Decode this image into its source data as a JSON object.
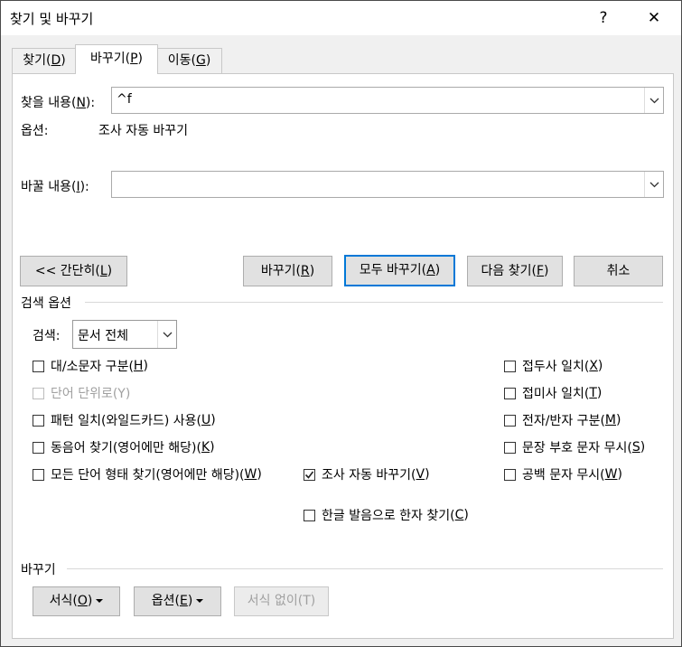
{
  "window": {
    "title": "찾기 및 바꾸기",
    "help": "?",
    "close": "✕"
  },
  "tabs": [
    {
      "label": "찾기(",
      "key": "D",
      "tail": ")"
    },
    {
      "label": "바꾸기(",
      "key": "P",
      "tail": ")"
    },
    {
      "label": "이동(",
      "key": "G",
      "tail": ")"
    }
  ],
  "find": {
    "label": "찾을 내용(",
    "key": "N",
    "tail": "):",
    "value": "^f"
  },
  "options_line": {
    "label": "옵션:",
    "value": "조사 자동 바꾸기"
  },
  "replace": {
    "label": "바꿀 내용(",
    "key": "I",
    "tail": "):",
    "value": ""
  },
  "buttons": {
    "less": {
      "label": "<< 간단히(",
      "key": "L",
      "tail": ")"
    },
    "replace": {
      "label": "바꾸기(",
      "key": "R",
      "tail": ")"
    },
    "replace_all": {
      "label": "모두 바꾸기(",
      "key": "A",
      "tail": ")"
    },
    "find_next": {
      "label": "다음 찾기(",
      "key": "F",
      "tail": ")"
    },
    "cancel": {
      "label": "취소"
    }
  },
  "search_options": {
    "heading": "검색 옵션",
    "search_label": "검색:",
    "search_value": "문서 전체",
    "left": [
      {
        "label": "대/소문자 구분(",
        "key": "H",
        "tail": ")",
        "checked": false,
        "disabled": false
      },
      {
        "label": "단어 단위로(Y)",
        "key": "",
        "tail": "",
        "checked": false,
        "disabled": true
      },
      {
        "label": "패턴 일치(와일드카드) 사용(",
        "key": "U",
        "tail": ")",
        "checked": false,
        "disabled": false
      },
      {
        "label": "동음어 찾기(영어에만 해당)(",
        "key": "K",
        "tail": ")",
        "checked": false,
        "disabled": false
      },
      {
        "label": "모든 단어 형태 찾기(영어에만 해당)(",
        "key": "W",
        "tail": ")",
        "checked": false,
        "disabled": false
      }
    ],
    "middle": [
      {
        "label": "조사 자동 바꾸기(",
        "key": "V",
        "tail": ")",
        "checked": true
      },
      {
        "label": "한글 발음으로 한자 찾기(",
        "key": "C",
        "tail": ")",
        "checked": false
      }
    ],
    "right": [
      {
        "label": "접두사 일치(",
        "key": "X",
        "tail": ")",
        "checked": false
      },
      {
        "label": "접미사 일치(",
        "key": "T",
        "tail": ")",
        "checked": false
      },
      {
        "label": "전자/반자 구분(",
        "key": "M",
        "tail": ")",
        "checked": false
      },
      {
        "label": "문장 부호 문자 무시(",
        "key": "S",
        "tail": ")",
        "checked": false
      },
      {
        "label": "공백 문자 무시(",
        "key": "W",
        "tail": ")",
        "checked": false
      }
    ]
  },
  "replace_section": {
    "heading": "바꾸기",
    "format": {
      "label": "서식(",
      "key": "O",
      "tail": ")"
    },
    "special": {
      "label": "옵션(",
      "key": "E",
      "tail": ")"
    },
    "no_format": {
      "label": "서식 없이(T)"
    }
  }
}
